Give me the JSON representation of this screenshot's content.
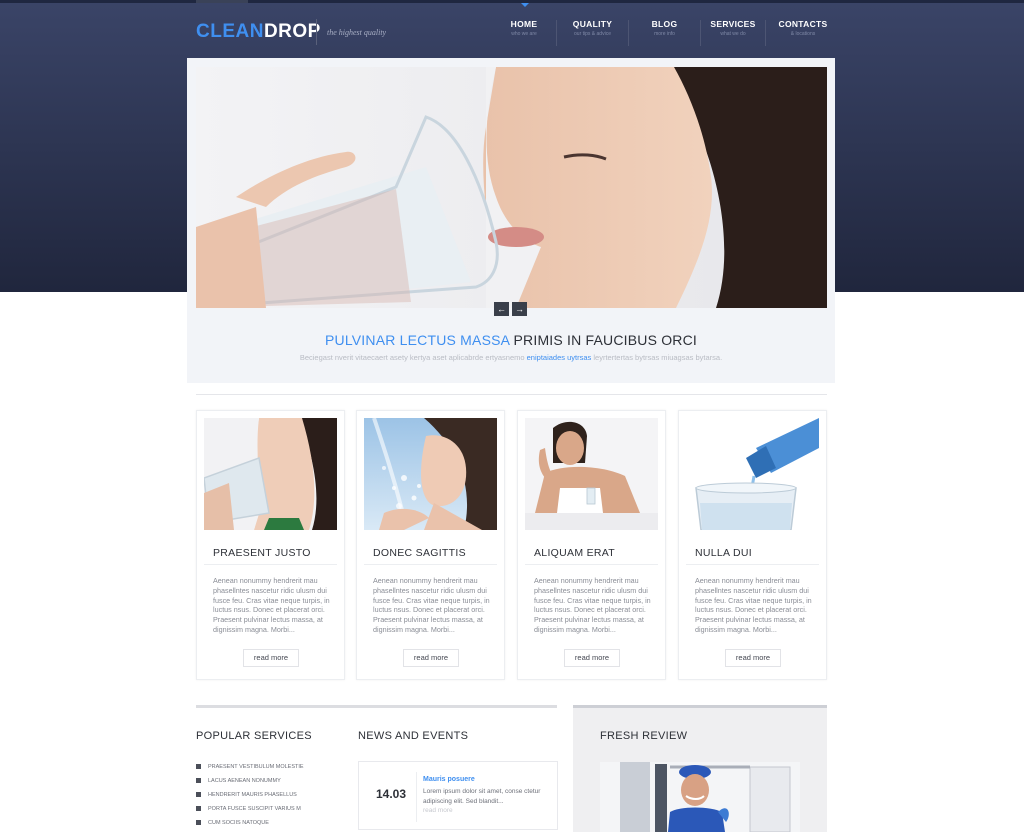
{
  "brand": {
    "logo_a": "CLEAN",
    "logo_b": "DROP",
    "tagline": "the highest quality"
  },
  "nav": [
    {
      "label": "HOME",
      "sub": "who we are",
      "active": true
    },
    {
      "label": "QUALITY",
      "sub": "our tips & advice",
      "active": false
    },
    {
      "label": "BLOG",
      "sub": "more info",
      "active": false
    },
    {
      "label": "SERVICES",
      "sub": "what we do",
      "active": false
    },
    {
      "label": "CONTACTS",
      "sub": "& locations",
      "active": false
    }
  ],
  "slider": {
    "prev": "←",
    "next": "→"
  },
  "intro": {
    "title_hl": "PULVINAR LECTUS MASSA",
    "title_rest": "PRIMIS IN FAUCIBUS ORCI",
    "text_a": "Beciegast nverit vitaecaert asety kertya aset aplicabrde ertyasnemo",
    "text_hl": "eniptaiades uytrsas",
    "text_b": "leyrtertertas bytrsas miuagsas bytarsa."
  },
  "cards": [
    {
      "title": "PRAESENT JUSTO",
      "text": "Aenean nonummy hendrerit mau phasellntes nascetur ridic ulusm dui fusce feu. Cras vitae neque turpis, in luctus nsus. Donec et placerat orci. Praesent pulvinar lectus massa, at dignissim magna. Morbi...",
      "button": "read more",
      "image": "woman-drinking-water"
    },
    {
      "title": "DONEC SAGITTIS",
      "text": "Aenean nonummy hendrerit mau phasellntes nascetur ridic ulusm dui fusce feu. Cras vitae neque turpis, in luctus nsus. Donec et placerat orci. Praesent pulvinar lectus massa, at dignissim magna. Morbi...",
      "button": "read more",
      "image": "woman-water-splash"
    },
    {
      "title": "ALIQUAM ERAT",
      "text": "Aenean nonummy hendrerit mau phasellntes nascetur ridic ulusm dui fusce feu. Cras vitae neque turpis, in luctus nsus. Donec et placerat orci. Praesent pulvinar lectus massa, at dignissim magna. Morbi...",
      "button": "read more",
      "image": "woman-with-glass"
    },
    {
      "title": "NULLA DUI",
      "text": "Aenean nonummy hendrerit mau phasellntes nascetur ridic ulusm dui fusce feu. Cras vitae neque turpis, in luctus nsus. Donec et placerat orci. Praesent pulvinar lectus massa, at dignissim magna. Morbi...",
      "button": "read more",
      "image": "bottle-pouring-water"
    }
  ],
  "popular": {
    "title": "POPULAR SERVICES",
    "items": [
      "PRAESENT VESTIBULUM MOLESTIE",
      "LACUS AENEAN NONUMMY",
      "HENDRERIT MAURIS PHASELLUS",
      "PORTA FUSCE SUSCIPIT VARIUS M",
      "CUM SOCIIS NATOQUE"
    ]
  },
  "news": {
    "title": "NEWS AND EVENTS",
    "date": "14.03",
    "item_title": "Mauris posuere",
    "item_text": "Lorem ipsum dolor sit amet, conse ctetur adipiscing elit. Sed blandit...",
    "more": "read more"
  },
  "review": {
    "title": "FRESH REVIEW",
    "image": "plumber-portrait"
  },
  "colors": {
    "accent": "#3f8ff0",
    "header": "#2a3150",
    "text": "#2d3037"
  }
}
